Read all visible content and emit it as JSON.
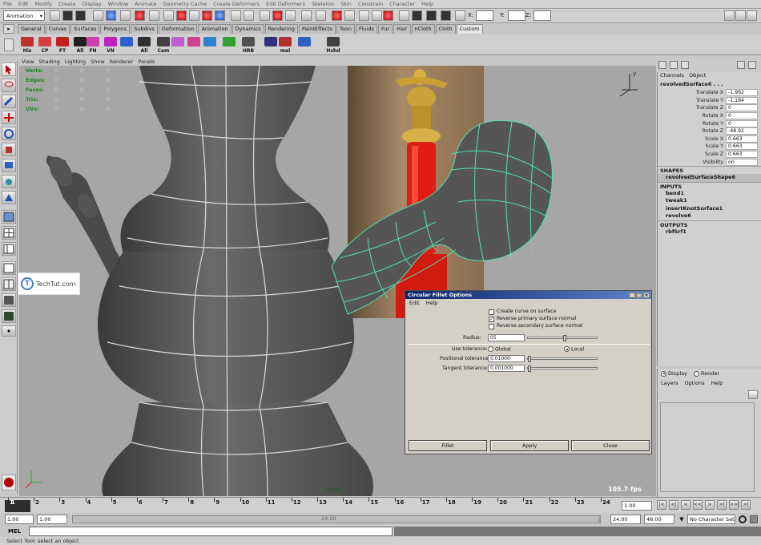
{
  "menubar": [
    "File",
    "Edit",
    "Modify",
    "Create",
    "Display",
    "Window",
    "Animate",
    "Geometry Cache",
    "Create Deformers",
    "Edit Deformers",
    "Skeleton",
    "Skin",
    "Constrain",
    "Character",
    "Help"
  ],
  "status": {
    "menu_set": "Animation",
    "x_label": "X:",
    "y_label": "Y:",
    "z_label": "Z:",
    "x_value": "",
    "y_value": "",
    "z_value": ""
  },
  "shelf_tabs": [
    {
      "label": "General",
      "active": false
    },
    {
      "label": "Curves",
      "active": false
    },
    {
      "label": "Surfaces",
      "active": false
    },
    {
      "label": "Polygons",
      "active": false
    },
    {
      "label": "Subdivs",
      "active": false
    },
    {
      "label": "Deformation",
      "active": false
    },
    {
      "label": "Animation",
      "active": false
    },
    {
      "label": "Dynamics",
      "active": false
    },
    {
      "label": "Rendering",
      "active": false
    },
    {
      "label": "PaintEffects",
      "active": false
    },
    {
      "label": "Toon",
      "active": false
    },
    {
      "label": "Fluids",
      "active": false
    },
    {
      "label": "Fur",
      "active": false
    },
    {
      "label": "Hair",
      "active": false
    },
    {
      "label": "nCloth",
      "active": false
    },
    {
      "label": "Cloth",
      "active": false
    },
    {
      "label": "Custom",
      "active": true
    }
  ],
  "shelf_icons": [
    {
      "label": "His",
      "icon": "history-icon",
      "color": "#c03030"
    },
    {
      "label": "CP",
      "icon": "center-pivot-icon",
      "color": "#d04040"
    },
    {
      "label": "FT",
      "icon": "freeze-transform-icon",
      "color": "#c02020"
    },
    {
      "label": "All",
      "icon": "delete-all-history-icon",
      "color": "#202020"
    },
    {
      "label": "FN",
      "icon": "face-normals-icon",
      "color": "#d03fb0"
    },
    {
      "label": "VN",
      "icon": "vertex-normals-icon",
      "color": "#c020c0"
    },
    {
      "label": "",
      "icon": "cube-icon",
      "color": "#3060d0"
    },
    {
      "label": "All",
      "icon": "select-all-icon",
      "color": "#303030"
    },
    {
      "label": "Cam",
      "icon": "camera-icon",
      "color": "#404040"
    },
    {
      "label": "",
      "icon": "sphere-multi-icon",
      "color": "#c060d0"
    },
    {
      "label": "",
      "icon": "sphere-icon",
      "color": "#d04090"
    },
    {
      "label": "",
      "icon": "light-icon",
      "color": "#3080d0"
    },
    {
      "label": "",
      "icon": "play-icon",
      "color": "#30a030"
    },
    {
      "label": "HRB",
      "icon": "render-icon",
      "color": "#505050"
    },
    {
      "label": "",
      "icon": "cross-icon",
      "color": "#303080"
    },
    {
      "label": "mel",
      "icon": "mel-script-icon",
      "color": "#b03030"
    },
    {
      "label": "",
      "icon": "download-icon",
      "color": "#3060c0"
    },
    {
      "label": "Hshd",
      "icon": "hypershade-icon",
      "color": "#404040"
    }
  ],
  "viewport_menu": [
    "View",
    "Shading",
    "Lighting",
    "Show",
    "Renderer",
    "Panels"
  ],
  "hud": [
    {
      "label": "Verts:",
      "values": [
        "0",
        "0",
        "0"
      ]
    },
    {
      "label": "Edges:",
      "values": [
        "0",
        "0",
        "0"
      ]
    },
    {
      "label": "Faces:",
      "values": [
        "0",
        "0",
        "0"
      ]
    },
    {
      "label": "Tris:",
      "values": [
        "0",
        "0",
        "0"
      ]
    },
    {
      "label": "UVs:",
      "values": [
        "0",
        "0",
        "0"
      ]
    }
  ],
  "viewport": {
    "fps": "105.7 fps",
    "camera": "persp"
  },
  "channel_box": {
    "tabs": [
      "Channels",
      "Object"
    ],
    "object": "revolvedSurface6 . . .",
    "attributes": [
      {
        "name": "Translate X",
        "value": "-1.962"
      },
      {
        "name": "Translate Y",
        "value": "-1.184"
      },
      {
        "name": "Translate Z",
        "value": "0"
      },
      {
        "name": "Rotate X",
        "value": "0"
      },
      {
        "name": "Rotate Y",
        "value": "0"
      },
      {
        "name": "Rotate Z",
        "value": "-48.92"
      },
      {
        "name": "Scale X",
        "value": "0.663"
      },
      {
        "name": "Scale Y",
        "value": "0.663"
      },
      {
        "name": "Scale Z",
        "value": "0.663"
      },
      {
        "name": "Visibility",
        "value": "on"
      }
    ],
    "shapes_header": "SHAPES",
    "shapes": [
      "revolvedSurfaceShape6"
    ],
    "inputs_header": "INPUTS",
    "inputs": [
      "bend1",
      "tweak1",
      "insertKnotSurface1",
      "revolve6"
    ],
    "outputs_header": "OUTPUTS",
    "outputs": [
      "rbfSrf1"
    ]
  },
  "layer_editor": {
    "display_label": "Display",
    "render_label": "Render",
    "menu": [
      "Layers",
      "Options",
      "Help"
    ]
  },
  "dialog": {
    "title": "Circular Fillet Options",
    "menu": [
      "Edit",
      "Help"
    ],
    "checkboxes": [
      {
        "label": "Create curve on surface",
        "checked": false
      },
      {
        "label": "Reverse primary surface normal",
        "checked": true
      },
      {
        "label": "Reverse secondary surface normal",
        "checked": false
      }
    ],
    "radius_label": "Radius:",
    "radius_value": "05",
    "use_tolerance_label": "Use tolerance:",
    "tol_global": "Global",
    "tol_local": "Local",
    "selected_tolerance": "Local",
    "positional_label": "Positional tolerance:",
    "positional_value": "0.01000",
    "tangent_label": "Tangent tolerance:",
    "tangent_value": "0.001000",
    "buttons": [
      "Fillet",
      "Apply",
      "Close"
    ]
  },
  "watermark": {
    "logo": "T",
    "text": "TechTut.com"
  },
  "timeslider": {
    "ticks": [
      "1",
      "2",
      "3",
      "4",
      "5",
      "6",
      "7",
      "8",
      "9",
      "10",
      "11",
      "12",
      "13",
      "14",
      "15",
      "16",
      "17",
      "18",
      "19",
      "20",
      "21",
      "22",
      "23",
      "24"
    ],
    "current": "1",
    "current_field": "1.00"
  },
  "playback": [
    "|<",
    "<|",
    "<",
    "<<",
    ">",
    ">|",
    ">>|",
    ">|"
  ],
  "range": {
    "start": "1.00",
    "inner_start": "1.00",
    "mid_label": "24.00",
    "end": "24.00",
    "outer_end": "48.00",
    "character_set": "No Character Set"
  },
  "command": {
    "label": "MEL"
  },
  "help_line": "Select Tool: select an object"
}
